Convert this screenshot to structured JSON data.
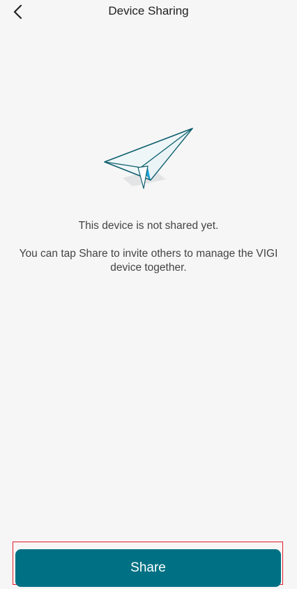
{
  "header": {
    "title": "Device Sharing",
    "back_icon": "chevron-left-icon"
  },
  "empty_state": {
    "illustration_icon": "paper-plane-icon",
    "primary_text": "This device is not shared yet.",
    "secondary_text": "You can tap Share to invite others to manage the VIGI device together."
  },
  "actions": {
    "share_label": "Share"
  },
  "colors": {
    "background": "#f6f6f6",
    "primary_button": "#007184",
    "highlight_outline": "#e11d2a",
    "plane_blue": "#1aa7e0",
    "plane_outline": "#0f5f6d"
  }
}
